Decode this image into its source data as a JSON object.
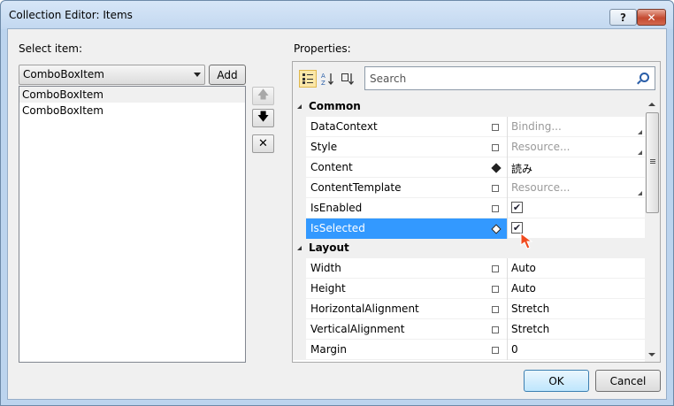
{
  "window": {
    "title": "Collection Editor: Items",
    "help_label": "?",
    "close_label": "✕"
  },
  "left": {
    "select_label": "Select item:",
    "type_combo_value": "ComboBoxItem",
    "add_label": "Add",
    "items": [
      "ComboBoxItem",
      "ComboBoxItem"
    ],
    "selected_index": 0
  },
  "side_buttons": {
    "move_up": "🡅",
    "move_down": "🡇",
    "remove": "✕"
  },
  "properties": {
    "label": "Properties:",
    "search_placeholder": "Search",
    "categories": [
      {
        "name": "Common",
        "rows": [
          {
            "name": "DataContext",
            "value": "Binding...",
            "hint": true,
            "marker": "empty",
            "corner": true
          },
          {
            "name": "Style",
            "value": "Resource...",
            "hint": true,
            "marker": "empty",
            "corner": true
          },
          {
            "name": "Content",
            "value": "読み",
            "hint": false,
            "marker": "set",
            "corner": false
          },
          {
            "name": "ContentTemplate",
            "value": "Resource...",
            "hint": true,
            "marker": "empty",
            "corner": true
          },
          {
            "name": "IsEnabled",
            "value": "✔",
            "checkbox": true,
            "marker": "empty"
          },
          {
            "name": "IsSelected",
            "value": "✔",
            "checkbox": true,
            "marker": "set",
            "selected": true
          }
        ]
      },
      {
        "name": "Layout",
        "rows": [
          {
            "name": "Width",
            "value": "Auto",
            "marker": "empty"
          },
          {
            "name": "Height",
            "value": "Auto",
            "marker": "empty"
          },
          {
            "name": "HorizontalAlignment",
            "value": "Stretch",
            "marker": "empty"
          },
          {
            "name": "VerticalAlignment",
            "value": "Stretch",
            "marker": "empty"
          },
          {
            "name": "Margin",
            "value": "0",
            "marker": "empty"
          }
        ]
      }
    ]
  },
  "footer": {
    "ok_label": "OK",
    "cancel_label": "Cancel"
  },
  "colors": {
    "selection": "#3399ff",
    "accent": "#2a5ea8"
  }
}
